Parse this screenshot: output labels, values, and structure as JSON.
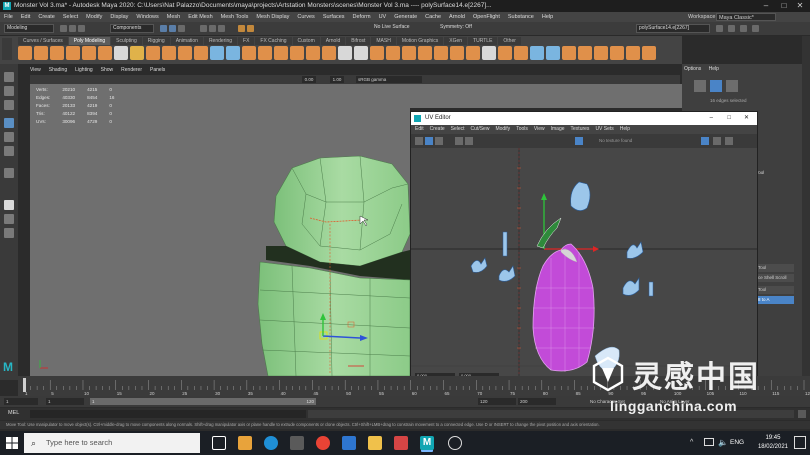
{
  "app": {
    "title": "Monster Vol 3.ma* - Autodesk Maya 2020: C:\\Users\\Nat Palazzo\\Documents\\maya\\projects\\Artstation Monsters\\scenes\\Monster Vol 3.ma  ----  polySurface14.e[2267]...",
    "icon_letter": "M",
    "accent": "#11a6b3"
  },
  "menubar": {
    "items": [
      "File",
      "Edit",
      "Create",
      "Select",
      "Modify",
      "Display",
      "Windows",
      "Mesh",
      "Edit Mesh",
      "Mesh Tools",
      "Mesh Display",
      "Curves",
      "Surfaces",
      "Deform",
      "UV",
      "Generate",
      "Cache",
      "Arnold",
      "OpenFlight",
      "Substance",
      "Help"
    ],
    "workspace_label": "Workspace :",
    "workspace_value": "Maya Classic*"
  },
  "statusline": {
    "mode": "Modeling",
    "components": "Components",
    "live_surface": "No Live Surface",
    "symmetry": "Symmetry: Off",
    "selection_field": "polySurface14.e[2267]"
  },
  "shelf": {
    "tabs": [
      "Curves / Surfaces",
      "Poly Modeling",
      "Sculpting",
      "Rigging",
      "Animation",
      "Rendering",
      "FX",
      "FX Caching",
      "Custom",
      "Arnold",
      "Bifrost",
      "MASH",
      "Motion Graphics",
      "XGen",
      "TURTLE",
      "Other"
    ],
    "active_tab": "Poly Modeling"
  },
  "viewport": {
    "menu": [
      "View",
      "Shading",
      "Lighting",
      "Show",
      "Renderer",
      "Panels"
    ],
    "hud": [
      {
        "label": "Verts:",
        "a": "20210",
        "b": "4215",
        "c": "0"
      },
      {
        "label": "Edges:",
        "a": "40330",
        "b": "8454",
        "c": "16"
      },
      {
        "label": "Faces:",
        "a": "20133",
        "b": "4219",
        "c": "0"
      },
      {
        "label": "Tris:",
        "a": "40122",
        "b": "8394",
        "c": "0"
      },
      {
        "label": "UVs:",
        "a": "30096",
        "b": "4729",
        "c": "0"
      }
    ],
    "gamma": "sRGB gamma",
    "exposure": "0.00",
    "gamma_value": "1.00"
  },
  "uv_editor": {
    "title": "UV Editor",
    "menu": [
      "Edit",
      "Create",
      "Select",
      "Cut/Sew",
      "Modify",
      "Tools",
      "View",
      "Image",
      "Textures",
      "UV Sets",
      "Help"
    ],
    "texture_field": "No texture found",
    "uv_axis_label": "UV",
    "bottom_left": "0.000",
    "bottom_right": "0.000"
  },
  "rightpanel": {
    "tabs": [
      "Options",
      "Help"
    ],
    "edges_selected": "16 edges selected",
    "side_labels": [
      "Tool",
      "ce Shell Scroll",
      "Tool",
      "8 to A"
    ]
  },
  "timeline": {
    "ticks": [
      "1",
      "5",
      "10",
      "15",
      "20",
      "25",
      "30",
      "35",
      "40",
      "45",
      "50",
      "55",
      "60",
      "65",
      "70",
      "75",
      "80",
      "85",
      "90",
      "95",
      "100",
      "105",
      "110",
      "115",
      "120"
    ],
    "range_start": "1",
    "range_start2": "1",
    "range_end": "120",
    "range_end2": "120",
    "anim_end": "200",
    "current_frame": "1",
    "no_char_set": "No Character Set",
    "no_anim_layer": "No Anim Layer"
  },
  "melbar": {
    "label": "MEL"
  },
  "helpline": {
    "text": "Move Tool: Use manipulator to move object(s). Ctrl+middle-drag to move components along normals. Shift+drag manipulator axis or plane handle to extrude components or clone objects. Ctrl+Shift+LMB+drag to constrain movement to a connected edge. Use D or INSERT to change the pivot position and axis orientation."
  },
  "taskbar": {
    "search_placeholder": "Type here to search",
    "language": "ENG",
    "time": "19:45",
    "date": "18/02/2021"
  },
  "watermark": {
    "chinese": "灵感中国",
    "url": "lingganchina.com"
  },
  "colors": {
    "mesh_green": "#9fd49a",
    "uv_magenta": "#c24bd8",
    "uv_shell_blue": "#7fb6e6",
    "axis_red": "#e02424",
    "axis_green": "#2ec43a"
  }
}
